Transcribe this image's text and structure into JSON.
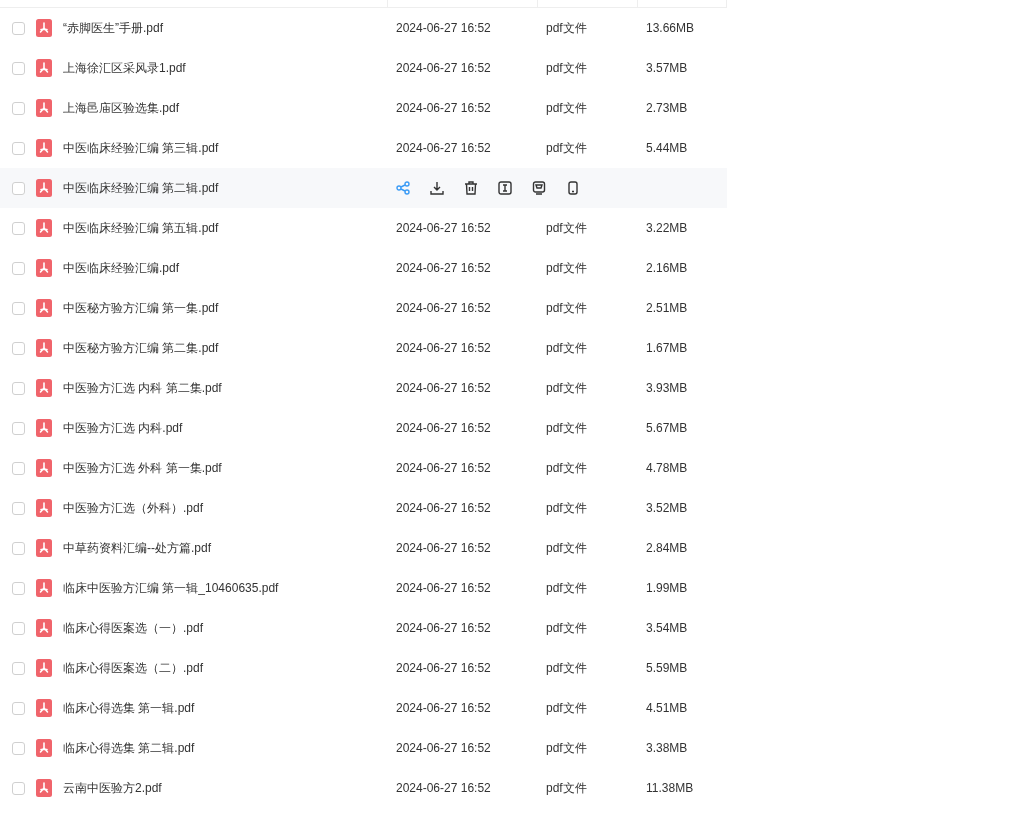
{
  "files": [
    {
      "name": "“赤脚医生”手册.pdf",
      "date": "2024-06-27 16:52",
      "type": "pdf文件",
      "size": "13.66MB",
      "checked": false,
      "hovered": false
    },
    {
      "name": "上海徐汇区采风录1.pdf",
      "date": "2024-06-27 16:52",
      "type": "pdf文件",
      "size": "3.57MB",
      "checked": false,
      "hovered": false
    },
    {
      "name": "上海邑庙区验选集.pdf",
      "date": "2024-06-27 16:52",
      "type": "pdf文件",
      "size": "2.73MB",
      "checked": false,
      "hovered": false
    },
    {
      "name": "中医临床经验汇编 第三辑.pdf",
      "date": "2024-06-27 16:52",
      "type": "pdf文件",
      "size": "5.44MB",
      "checked": false,
      "hovered": false
    },
    {
      "name": "中医临床经验汇编 第二辑.pdf",
      "checked": false,
      "hovered": true
    },
    {
      "name": "中医临床经验汇编 第五辑.pdf",
      "date": "2024-06-27 16:52",
      "type": "pdf文件",
      "size": "3.22MB",
      "checked": false,
      "hovered": false
    },
    {
      "name": "中医临床经验汇编.pdf",
      "date": "2024-06-27 16:52",
      "type": "pdf文件",
      "size": "2.16MB",
      "checked": false,
      "hovered": false
    },
    {
      "name": "中医秘方验方汇编 第一集.pdf",
      "date": "2024-06-27 16:52",
      "type": "pdf文件",
      "size": "2.51MB",
      "checked": false,
      "hovered": false
    },
    {
      "name": "中医秘方验方汇编 第二集.pdf",
      "date": "2024-06-27 16:52",
      "type": "pdf文件",
      "size": "1.67MB",
      "checked": false,
      "hovered": false
    },
    {
      "name": "中医验方汇选 内科 第二集.pdf",
      "date": "2024-06-27 16:52",
      "type": "pdf文件",
      "size": "3.93MB",
      "checked": false,
      "hovered": false
    },
    {
      "name": "中医验方汇选 内科.pdf",
      "date": "2024-06-27 16:52",
      "type": "pdf文件",
      "size": "5.67MB",
      "checked": false,
      "hovered": false
    },
    {
      "name": "中医验方汇选 外科 第一集.pdf",
      "date": "2024-06-27 16:52",
      "type": "pdf文件",
      "size": "4.78MB",
      "checked": false,
      "hovered": false
    },
    {
      "name": "中医验方汇选（外科）.pdf",
      "date": "2024-06-27 16:52",
      "type": "pdf文件",
      "size": "3.52MB",
      "checked": false,
      "hovered": false
    },
    {
      "name": "中草药资料汇编--处方篇.pdf",
      "date": "2024-06-27 16:52",
      "type": "pdf文件",
      "size": "2.84MB",
      "checked": false,
      "hovered": false
    },
    {
      "name": "临床中医验方汇编 第一辑_10460635.pdf",
      "date": "2024-06-27 16:52",
      "type": "pdf文件",
      "size": "1.99MB",
      "checked": false,
      "hovered": false
    },
    {
      "name": "临床心得医案选（一）.pdf",
      "date": "2024-06-27 16:52",
      "type": "pdf文件",
      "size": "3.54MB",
      "checked": false,
      "hovered": false
    },
    {
      "name": "临床心得医案选（二）.pdf",
      "date": "2024-06-27 16:52",
      "type": "pdf文件",
      "size": "5.59MB",
      "checked": false,
      "hovered": false
    },
    {
      "name": "临床心得选集 第一辑.pdf",
      "date": "2024-06-27 16:52",
      "type": "pdf文件",
      "size": "4.51MB",
      "checked": false,
      "hovered": false
    },
    {
      "name": "临床心得选集 第二辑.pdf",
      "date": "2024-06-27 16:52",
      "type": "pdf文件",
      "size": "3.38MB",
      "checked": false,
      "hovered": false
    },
    {
      "name": "云南中医验方2.pdf",
      "date": "2024-06-27 16:52",
      "type": "pdf文件",
      "size": "11.38MB",
      "checked": false,
      "hovered": false
    }
  ]
}
